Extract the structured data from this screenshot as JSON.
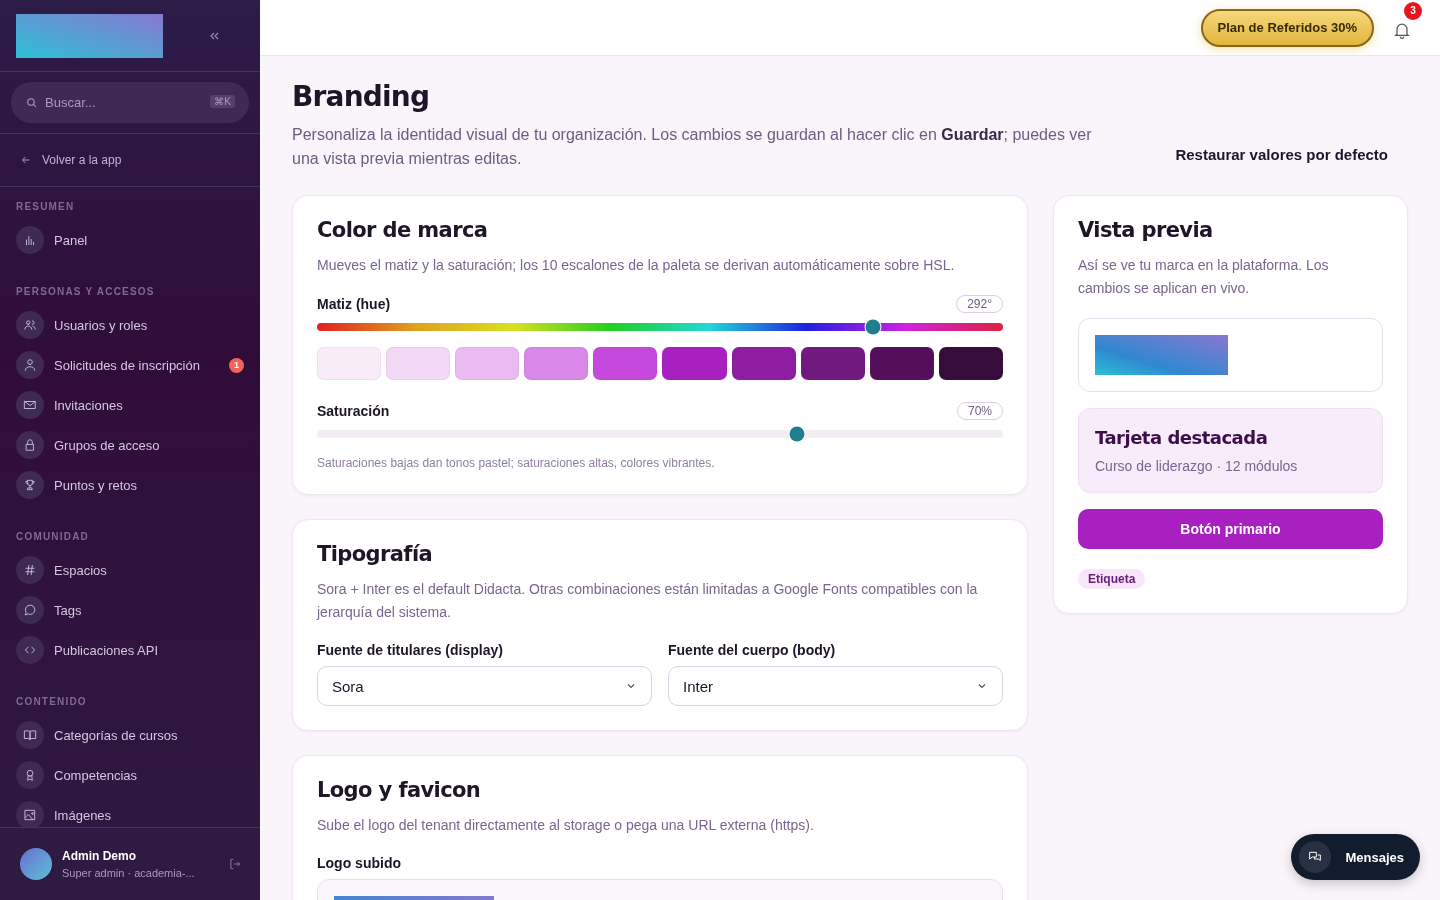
{
  "sidebar": {
    "search": {
      "placeholder": "Buscar...",
      "shortcut": "⌘K"
    },
    "back_link": "Volver a la app",
    "sections": [
      {
        "title": "RESUMEN",
        "items": [
          {
            "label": "Panel"
          }
        ]
      },
      {
        "title": "PERSONAS Y ACCESOS",
        "items": [
          {
            "label": "Usuarios y roles"
          },
          {
            "label": "Solicitudes de inscripción",
            "badge": "1"
          },
          {
            "label": "Invitaciones"
          },
          {
            "label": "Grupos de acceso"
          },
          {
            "label": "Puntos y retos"
          }
        ]
      },
      {
        "title": "COMUNIDAD",
        "items": [
          {
            "label": "Espacios"
          },
          {
            "label": "Tags"
          },
          {
            "label": "Publicaciones API"
          }
        ]
      },
      {
        "title": "CONTENIDO",
        "items": [
          {
            "label": "Categorías de cursos"
          },
          {
            "label": "Competencias"
          },
          {
            "label": "Imágenes"
          }
        ]
      }
    ],
    "user": {
      "name": "Admin Demo",
      "subtitle": "Super admin · academia-..."
    }
  },
  "topbar": {
    "referral_button": "Plan de Referidos 30%",
    "notification_count": "3"
  },
  "page": {
    "title": "Branding",
    "description": "Personaliza la identidad visual de tu organización. Los cambios se guardan al hacer clic en **Guardar**; puedes ver una vista previa mientras editas.",
    "restore_button": "Restaurar valores por defecto"
  },
  "brand_color": {
    "title": "Color de marca",
    "description": "Mueves el matiz y la saturación; los 10 escalones de la paleta se derivan automáticamente sobre HSL.",
    "hue": {
      "label": "Matiz (hue)",
      "reading": "292°",
      "level": 0.81
    },
    "palette": [
      {
        "color": "#f8ecf9"
      },
      {
        "color": "#f3d9f6"
      },
      {
        "color": "#e9bbf0"
      },
      {
        "color": "#da88e8"
      },
      {
        "color": "#c748dd"
      },
      {
        "color": "#a820c0"
      },
      {
        "color": "#8e1ea1"
      },
      {
        "color": "#701a80"
      },
      {
        "color": "#540f5a"
      },
      {
        "color": "#360c3a"
      }
    ],
    "saturation": {
      "label": "Saturación",
      "reading": "70%",
      "level": 0.7
    },
    "hint": "Saturaciones bajas dan tonos pastel; saturaciones altas, colores vibrantes."
  },
  "typography": {
    "title": "Tipografía",
    "description": "Sora + Inter es el default Didacta. Otras combinaciones están limitadas a Google Fonts compatibles con la jerarquía del sistema.",
    "fields": [
      {
        "label": "Fuente de titulares (display)",
        "value": "Sora"
      },
      {
        "label": "Fuente del cuerpo (body)",
        "value": "Inter"
      }
    ]
  },
  "logo": {
    "title": "Logo y favicon",
    "description": "Sube el logo del tenant directamente al storage o pega una URL externa (https).",
    "uploaded_label": "Logo subido"
  },
  "preview": {
    "title": "Vista previa",
    "description": "Así se ve tu marca en la plataforma. Los cambios se aplican en vivo.",
    "card_title": "Tarjeta destacada",
    "card_subtitle": "Curso de liderazgo · 12 módulos",
    "primary_button": "Botón primario",
    "tag": "Etiqueta"
  },
  "messages_button": "Mensajes"
}
